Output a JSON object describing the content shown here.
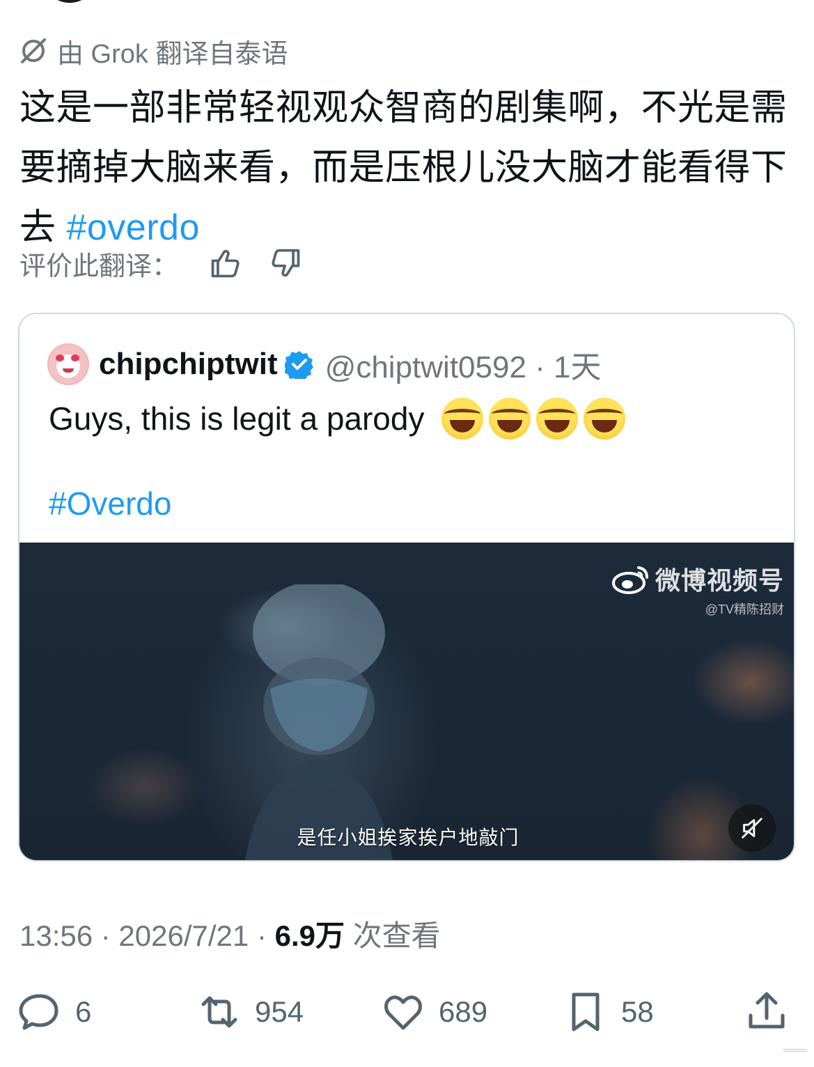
{
  "translation": {
    "label": "由 Grok 翻译自泰语",
    "icon": "grok-slash-icon"
  },
  "post": {
    "text": "这是一部非常轻视观众智商的剧集啊，不光是需要摘掉大脑来看，而是压根儿没大脑才能看得下去 ",
    "hashtag": "#overdo"
  },
  "rating": {
    "label": "评价此翻译：",
    "up_icon": "thumbs-up-icon",
    "down_icon": "thumbs-down-icon"
  },
  "quote": {
    "name": "chipchiptwit",
    "handle": "@chiptwit0592 · 1天",
    "text": "Guys, this is legit a parody",
    "emoji": "face-with-tears-of-joy",
    "hashtag": "#Overdo",
    "video": {
      "watermark_main": "微博视频号",
      "watermark_sub": "@TV精陈招财",
      "subtitle": "是任小姐挨家挨户地敲门",
      "mute_icon": "speaker-muted-icon"
    }
  },
  "meta": {
    "time_date": "13:56 · 2026/7/21 · ",
    "views": "6.9万",
    "views_suffix": " 次查看"
  },
  "actions": {
    "reply_count": "6",
    "repost_count": "954",
    "like_count": "689",
    "bookmark_count": "58"
  },
  "colors": {
    "accent": "#1d9bf0",
    "text": "#0f1419",
    "muted": "#6e767d"
  }
}
